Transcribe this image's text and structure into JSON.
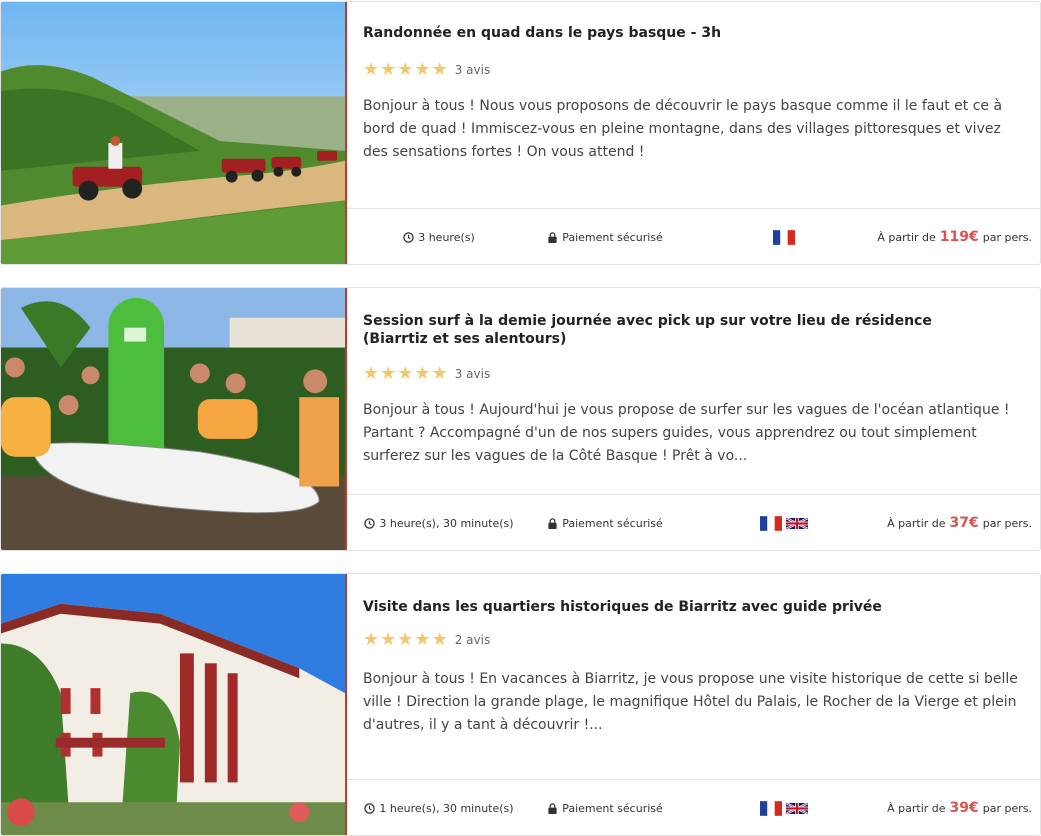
{
  "cards": [
    {
      "title": "Randonnée en quad dans le pays basque - 3h",
      "reviews": "3 avis",
      "rating": 5,
      "description": "Bonjour à tous ! Nous vous proposons de découvrir le pays basque comme il le faut et ce à bord de quad ! Immiscez-vous en pleine montagne, dans des villages pittoresques et vivez des sensations fortes ! On vous attend !",
      "duration": "3 heure(s)",
      "payment": "Paiement sécurisé",
      "flags": [
        "fr"
      ],
      "price_prefix": "À partir de",
      "price": "119€",
      "price_suffix": "par pers."
    },
    {
      "title": "Session surf à la demie journée avec pick up sur votre lieu de résidence (Biarrtiz et ses alentours)",
      "reviews": "3 avis",
      "rating": 5,
      "description": "Bonjour à tous ! Aujourd'hui je vous propose de surfer sur les vagues de l'océan atlantique ! Partant ? Accompagné d'un de nos supers guides, vous apprendrez ou tout simplement surferez sur les vagues de la Côté Basque ! Prêt à vo...",
      "duration": "3 heure(s), 30 minute(s)",
      "payment": "Paiement sécurisé",
      "flags": [
        "fr",
        "uk"
      ],
      "price_prefix": "À partir de",
      "price": "37€",
      "price_suffix": "par pers."
    },
    {
      "title": "Visite dans les quartiers historiques de Biarritz avec guide privée",
      "reviews": "2 avis",
      "rating": 5,
      "description": "Bonjour à tous ! En vacances à Biarritz, je vous propose une visite historique de cette si belle ville ! Direction la grande plage, le magnifique Hôtel du Palais, le Rocher de la Vierge et plein d'autres, il y a tant à découvrir !...",
      "duration": "1 heure(s), 30 minute(s)",
      "payment": "Paiement sécurisé",
      "flags": [
        "fr",
        "uk"
      ],
      "price_prefix": "À partir de",
      "price": "39€",
      "price_suffix": "par pers."
    }
  ],
  "colors": {
    "accent": "#d9534f",
    "star": "#f6c66b",
    "divider": "#c0392b"
  },
  "icons": {
    "duration": "clock-icon",
    "payment": "lock-icon",
    "star": "star-icon"
  }
}
